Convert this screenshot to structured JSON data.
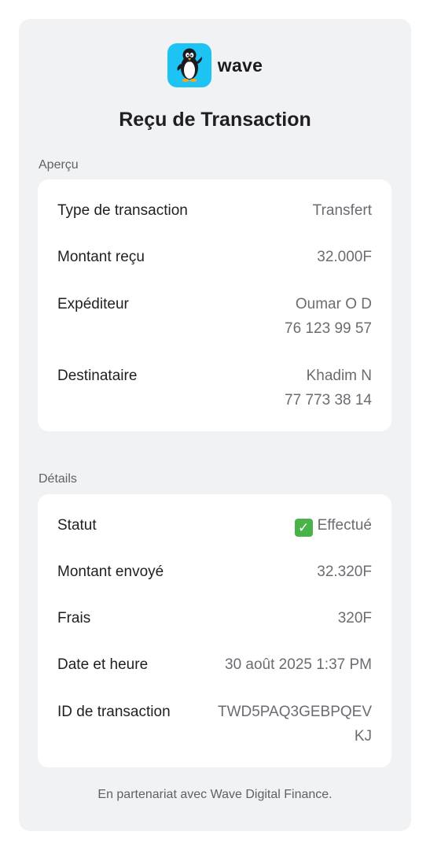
{
  "brand": {
    "name": "wave",
    "color": "#1dc3f2"
  },
  "title": "Reçu de Transaction",
  "overview": {
    "label": "Aperçu",
    "rows": [
      {
        "key": "Type de transaction",
        "value": [
          "Transfert"
        ]
      },
      {
        "key": "Montant reçu",
        "value": [
          "32.000F"
        ]
      },
      {
        "key": "Expéditeur",
        "value": [
          "Oumar O D",
          "76 123 99 57"
        ]
      },
      {
        "key": "Destinataire",
        "value": [
          "Khadim N",
          "77 773 38 14"
        ]
      }
    ]
  },
  "details": {
    "label": "Détails",
    "status": {
      "key": "Statut",
      "value": "Effectué",
      "icon": "check-icon",
      "color": "#49b34a"
    },
    "rows": [
      {
        "key": "Montant envoyé",
        "value": [
          "32.320F"
        ]
      },
      {
        "key": "Frais",
        "value": [
          "320F"
        ]
      },
      {
        "key": "Date et heure",
        "value": [
          "30 août 2025 1:37 PM"
        ]
      },
      {
        "key": "ID de transaction",
        "value": [
          "TWD5PAQ3GEBPQEV",
          "KJ"
        ]
      }
    ]
  },
  "footer": "En partenariat avec Wave Digital Finance."
}
